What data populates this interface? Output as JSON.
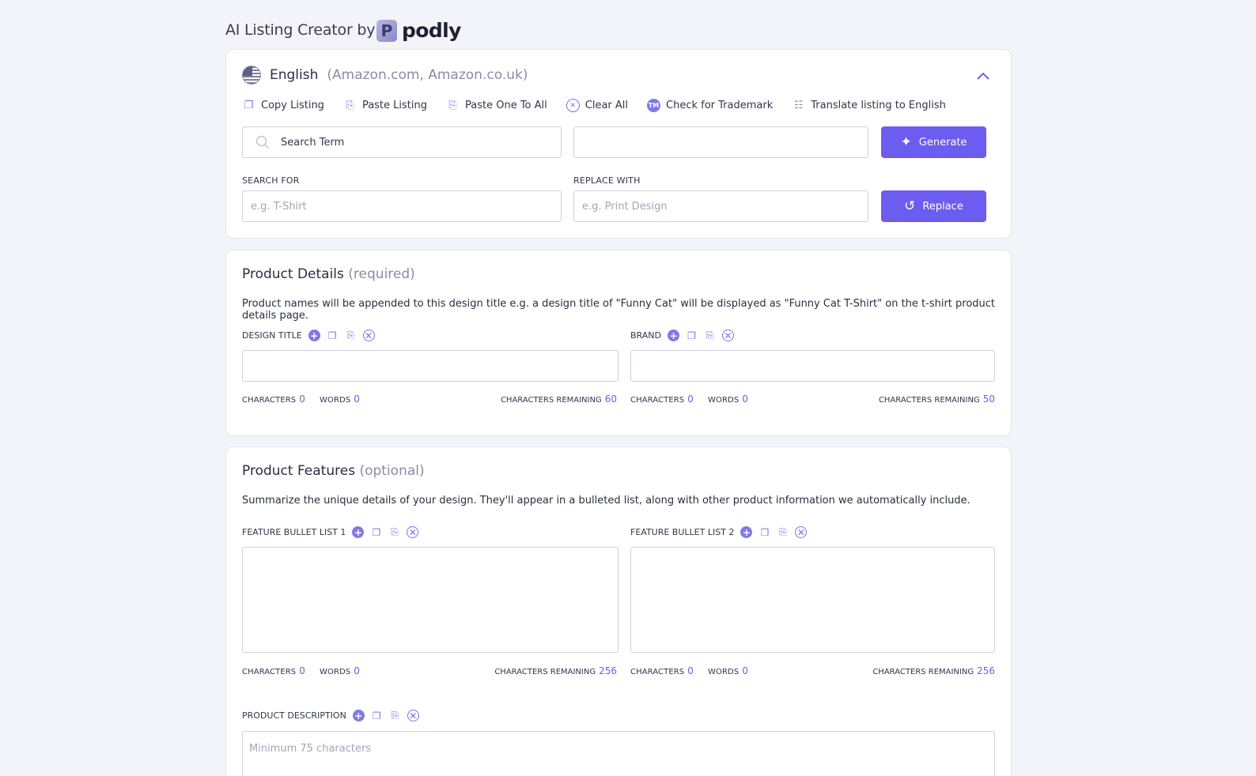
{
  "header": {
    "title": "AI Listing Creator by",
    "logo_mark": "P",
    "logo_text": "podly"
  },
  "language": {
    "name": "English",
    "markets": "(Amazon.com, Amazon.co.uk)",
    "flag_icon": "us-flag-icon",
    "collapse_icon": "chevron-up-icon"
  },
  "toolbar": [
    {
      "label": "Copy Listing",
      "icon": "copy-icon"
    },
    {
      "label": "Paste Listing",
      "icon": "clipboard-icon"
    },
    {
      "label": "Paste One To All",
      "icon": "clipboard-icon"
    },
    {
      "label": "Clear All",
      "icon": "clear-icon"
    },
    {
      "label": "Check for Trademark",
      "icon": "trademark-icon",
      "glyph": "TM"
    },
    {
      "label": "Translate listing to English",
      "icon": "translate-icon"
    }
  ],
  "search": {
    "term_placeholder": "Search Term",
    "generate_label": "Generate"
  },
  "replace": {
    "search_for_label": "SEARCH FOR",
    "search_for_placeholder": "e.g. T-Shirt",
    "replace_with_label": "REPLACE WITH",
    "replace_with_placeholder": "e.g. Print Design",
    "replace_label": "Replace"
  },
  "product_details": {
    "title": "Product Details",
    "tag": "(required)",
    "description": "Product names will be appended to this design title e.g. a design title of \"Funny Cat\" will be displayed as \"Funny Cat T-Shirt\" on the t-shirt product details page.",
    "fields": [
      {
        "label": "DESIGN TITLE",
        "characters": "0",
        "words": "0",
        "remaining": "60"
      },
      {
        "label": "BRAND",
        "characters": "0",
        "words": "0",
        "remaining": "50"
      }
    ]
  },
  "product_features": {
    "title": "Product Features",
    "tag": "(optional)",
    "description": "Summarize the unique details of your design. They'll appear in a bulleted list, along with other product information we automatically include.",
    "fields": [
      {
        "label": "FEATURE BULLET LIST 1",
        "characters": "0",
        "words": "0",
        "remaining": "256"
      },
      {
        "label": "FEATURE BULLET LIST 2",
        "characters": "0",
        "words": "0",
        "remaining": "256"
      }
    ],
    "description_field": {
      "label": "PRODUCT DESCRIPTION",
      "placeholder": "Minimum 75 characters"
    }
  },
  "count_labels": {
    "characters": "CHARACTERS",
    "words": "WORDS",
    "remaining": "CHARACTERS REMAINING"
  },
  "colors": {
    "accent": "#6c5cf0",
    "background": "#f3f4f9"
  }
}
